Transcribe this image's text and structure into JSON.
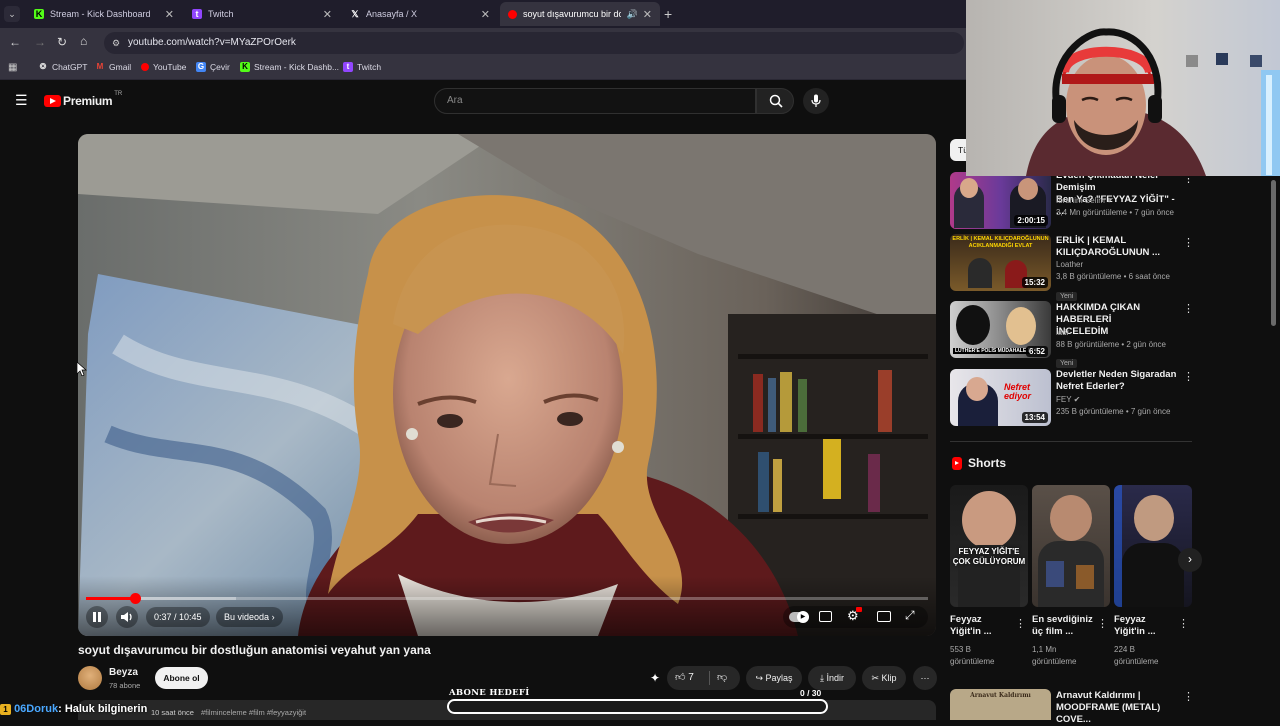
{
  "browser": {
    "tabs": [
      {
        "label": "Stream - Kick Dashboard",
        "icon": "kick-icon",
        "color": "#53fc18"
      },
      {
        "label": "Twitch",
        "icon": "twitch-icon",
        "color": "#9146ff"
      },
      {
        "label": "Anasayfa / X",
        "icon": "x-icon",
        "color": "#ffffff"
      },
      {
        "label": "soyut dışavurumcu bir dostl",
        "icon": "youtube-icon",
        "color": "#ff0000"
      }
    ],
    "url": "youtube.com/watch?v=MYaZPOrOerk",
    "bookmarks": [
      "ChatGPT",
      "Gmail",
      "YouTube",
      "Çevir",
      "Stream - Kick Dashb...",
      "Twitch"
    ]
  },
  "youtube": {
    "logo_text": "Premium",
    "logo_sup": "TR",
    "search_placeholder": "Ara",
    "chip_fragment": "Tü"
  },
  "player": {
    "time": "0:37 / 10:45",
    "chapter": "Bu videoda",
    "progress_fraction": 0.058
  },
  "video": {
    "title": "soyut dışavurumcu bir dostluğun anatomisi veyahut yan yana",
    "channel": "Beyza",
    "subscribers": "78 abone",
    "subscribe_label": "Abone ol",
    "likes": "7",
    "share_label": "Paylaş",
    "download_label": "İndir",
    "clip_label": "Klip",
    "desc_fragment_meta": "10 saat önce",
    "desc_fragment_tags": "#filminceleme #film #feyyazyiğit"
  },
  "related": [
    {
      "title1": "Evden Çıkmadan Neler Demişim",
      "title2": "Ben Ya? \"FEYYAZ YİĞİT\" - ...",
      "channel": "İbrahim Selim",
      "verified": true,
      "meta": "3,4 Mn görüntüleme • 7 gün önce",
      "duration": "2:00:15",
      "badge": ""
    },
    {
      "title1": "ERLİK | KEMAL",
      "title2": "KILIÇDAROĞLUNUN ...",
      "channel": "Loather",
      "verified": false,
      "meta": "3,8 B görüntüleme • 6 saat önce",
      "duration": "15:32",
      "badge": "Yeni"
    },
    {
      "title1": "HAKKIMDA ÇIKAN HABERLERİ",
      "title2": "İNCELEDİM",
      "channel": "ladr",
      "verified": false,
      "meta": "88 B görüntüleme • 2 gün önce",
      "duration": "6:52",
      "badge": "Yeni"
    },
    {
      "title1": "Devletler Neden Sigaradan",
      "title2": "Nefret Ederler?",
      "channel": "FEY",
      "verified": true,
      "meta": "235 B görüntüleme • 7 gün önce",
      "duration": "13:54",
      "badge": ""
    }
  ],
  "thumb_texts": {
    "t2": "ERLİK | KEMAL KILIÇDAROĞLUNUN ACIKLANMADIĞI EVLAT",
    "t3": "LUTHER'E POLİS MÜDAHALE ETTİ",
    "t4": "Nefret ediyor"
  },
  "shorts": {
    "heading": "Shorts",
    "items": [
      {
        "title1": "Feyyaz",
        "title2": "Yiğit'in ...",
        "views1": "553 B",
        "views2": "görüntüleme",
        "overlay": "FEYYAZ YİĞİT'E ÇOK GÜLÜYORUM"
      },
      {
        "title1": "En sevdiğiniz",
        "title2": "üç film ...",
        "views1": "1,1 Mn",
        "views2": "görüntüleme",
        "overlay": ""
      },
      {
        "title1": "Feyyaz",
        "title2": "Yiğit'in ...",
        "views1": "224 B",
        "views2": "görüntüleme",
        "overlay": ""
      }
    ]
  },
  "next_related": {
    "title1": "Arnavut Kaldırımı |",
    "title2": "MOODFRAME (METAL) COVE...",
    "thumb_text": "Arnavut Kaldırımı"
  },
  "overlay": {
    "goal_label": "ABONE HEDEFİ",
    "goal_count": "0 / 30",
    "goal_fraction": 0,
    "chat_user": "06Doruk",
    "chat_msg": ": Haluk bilginerin"
  },
  "colors": {
    "accent_red": "#ff0000",
    "browser_bg": "#35333f",
    "yt_bg": "#0f0f0f"
  }
}
